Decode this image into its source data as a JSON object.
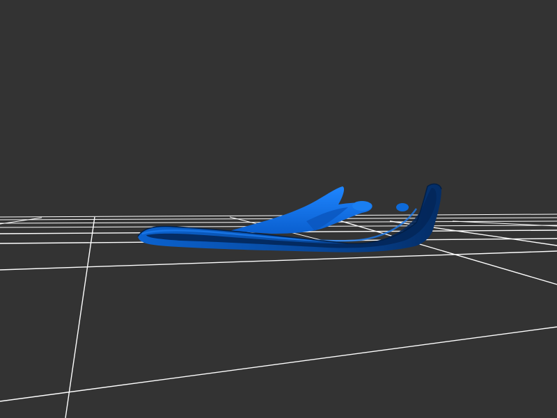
{
  "scene": {
    "background_color": "#333333",
    "grid_color": "#ffffff",
    "model": {
      "color_primary": "#0a6ee0",
      "color_mid": "#0b5cbd",
      "color_dark": "#063b80",
      "color_edge": "#021f47"
    }
  }
}
